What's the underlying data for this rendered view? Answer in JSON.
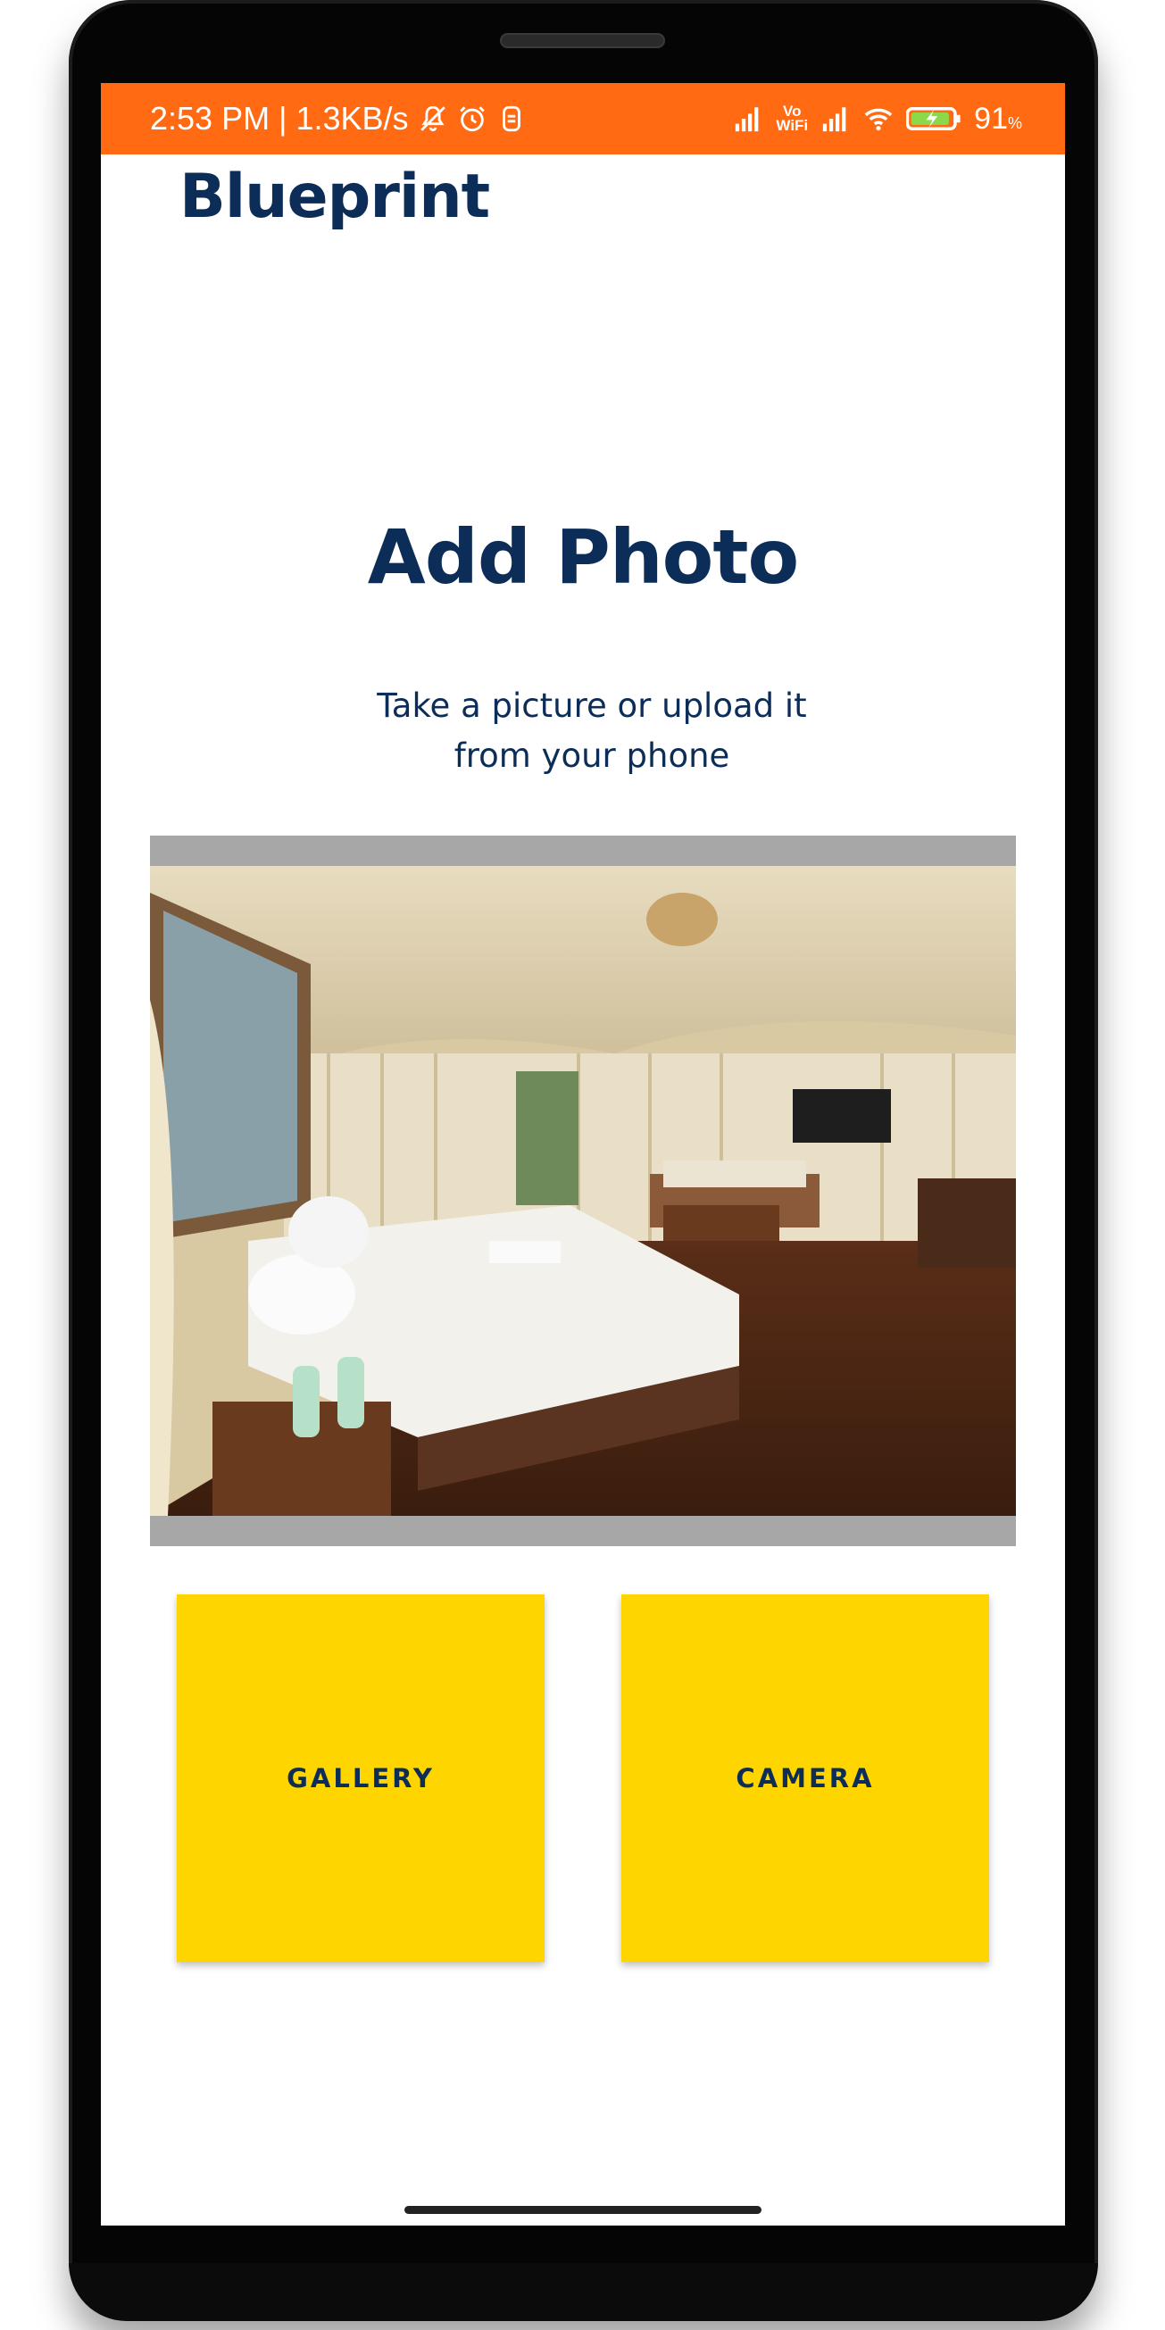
{
  "status_bar": {
    "time": "2:53 PM",
    "speed": "1.3KB/s",
    "battery_percent": "91",
    "battery_unit": "%",
    "vowifi_top": "Vo",
    "vowifi_bottom": "WiFi",
    "color": "#ff6a13"
  },
  "app": {
    "logo": "Blueprint",
    "brand_color": "#0c2d57"
  },
  "main": {
    "title": "Add Photo",
    "subtitle": "Take a picture or upload it from your phone",
    "photo_icon": "tent-bedroom-photo"
  },
  "buttons": {
    "gallery_label": "GALLERY",
    "camera_label": "CAMERA",
    "color": "#ffd500"
  }
}
